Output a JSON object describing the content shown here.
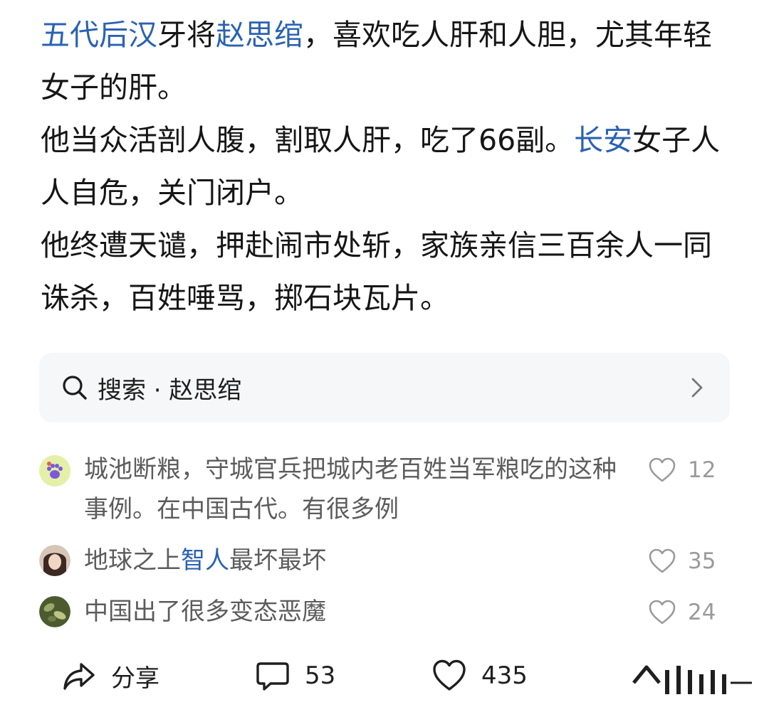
{
  "post": {
    "p1_link1": "五代后汉",
    "p1_mid": "牙将",
    "p1_link2": "赵思绾",
    "p1_rest": "，喜欢吃人肝和人胆，尤其年轻女子的肝。",
    "p2_main": "他当众活剖人腹，割取人肝，吃了66副。",
    "p2_link": "长安",
    "p2_rest": "女子人人自危，关门闭户。",
    "p3": "他终遭天谴，押赴闹市处斩，家族亲信三百余人一同诛杀，百姓唾骂，掷石块瓦片。"
  },
  "search": {
    "icon": "search-icon",
    "label": "搜索 · 赵思绾"
  },
  "comments": [
    {
      "text": "城池断粮，守城官兵把城内老百姓当军粮吃的这种事例。在中国古代。有很多例",
      "likes": "12"
    },
    {
      "text_pre": "地球之上",
      "text_link": "智人",
      "text_post": "最坏最坏",
      "likes": "35"
    },
    {
      "text": "中国出了很多变态恶魔",
      "likes": "24"
    }
  ],
  "toolbar": {
    "share_label": "分享",
    "comment_count": "53",
    "like_count": "435"
  },
  "colors": {
    "link": "#2a62b3",
    "comment_text": "#5c5c5c",
    "count_gray": "#9a9a9a",
    "search_bg": "#f6f7f9"
  }
}
